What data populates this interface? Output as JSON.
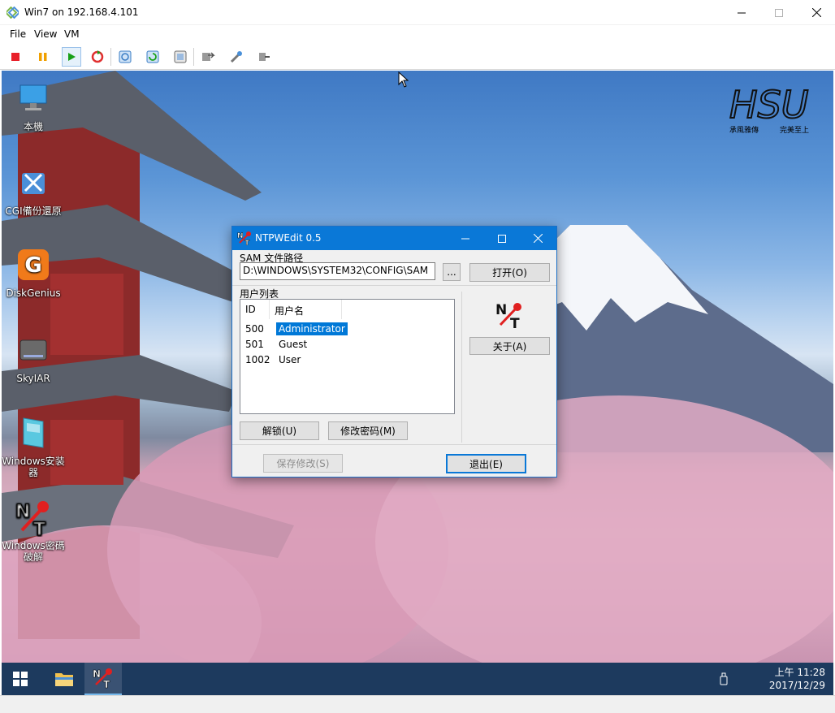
{
  "window": {
    "title": "Win7 on 192.168.4.101"
  },
  "menu": {
    "items": [
      "File",
      "View",
      "VM"
    ]
  },
  "toolbar": {
    "icons": [
      "stop-icon",
      "pause-icon",
      "start-icon",
      "reset-icon",
      "checkpoint-icon",
      "revert-icon",
      "snapshot-icon",
      "share-icon",
      "settings-icon",
      "enhanced-icon"
    ],
    "colors": {
      "stop": "#e8202a",
      "pause": "#f0a000",
      "start": "#18a018",
      "reset": "#e03030"
    }
  },
  "desktop": {
    "icons": [
      {
        "label": "本機",
        "icon": "computer-icon"
      },
      {
        "label": "CGI備份還原",
        "icon": "cgi-backup-icon"
      },
      {
        "label": "DiskGenius",
        "icon": "diskgenius-icon"
      },
      {
        "label": "SkyIAR",
        "icon": "skyiar-icon"
      },
      {
        "label": "Windows安装器",
        "icon": "windows-installer-icon"
      },
      {
        "label": "Windows密碼破解",
        "icon": "nt-password-icon"
      }
    ],
    "logo": {
      "text": "HSU",
      "left": "承風雅傳",
      "right": "完美至上"
    }
  },
  "dialog": {
    "title": "NTPWEdit 0.5",
    "sam_label": "SAM 文件路径",
    "sam_path": "D:\\WINDOWS\\SYSTEM32\\CONFIG\\SAM",
    "browse_label": "...",
    "open_label": "打开(O)",
    "userlist_label": "用户列表",
    "columns": [
      "ID",
      "用户名"
    ],
    "users": [
      {
        "id": "500",
        "name": "Administrator",
        "selected": true
      },
      {
        "id": "501",
        "name": "Guest",
        "selected": false
      },
      {
        "id": "1002",
        "name": "User",
        "selected": false
      }
    ],
    "about_label": "关于(A)",
    "unlock_label": "解锁(U)",
    "change_password_label": "修改密码(M)",
    "save_label": "保存修改(S)",
    "exit_label": "退出(E)"
  },
  "taskbar": {
    "time": "上午 11:28",
    "date": "2017/12/29"
  },
  "colors": {
    "accent": "#0a78d7",
    "taskbar": "#1d3a5e",
    "selection": "#0078d7"
  }
}
